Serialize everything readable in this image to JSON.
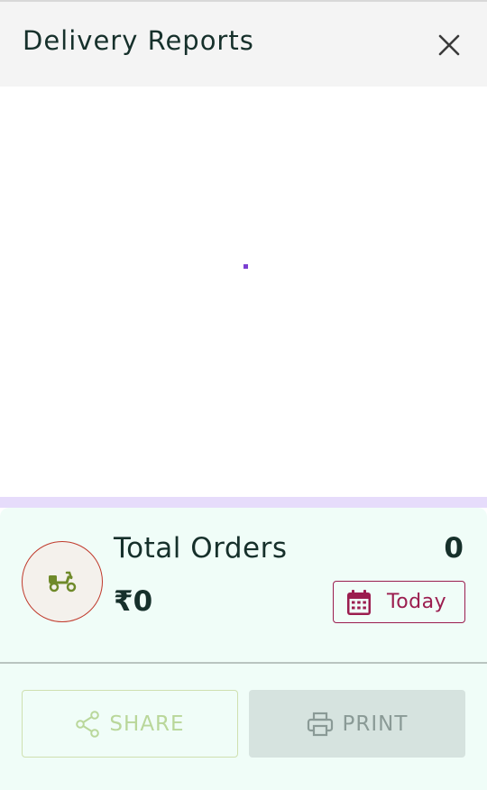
{
  "header": {
    "title": "Delivery Reports"
  },
  "summary": {
    "orders_label": "Total Orders",
    "orders_count": "0",
    "amount": "₹0",
    "date_filter_label": "Today"
  },
  "actions": {
    "share_label": "SHARE",
    "print_label": "PRINT"
  },
  "icons": {
    "close": "close-icon",
    "scooter": "scooter-icon",
    "calendar": "calendar-icon",
    "share": "share-icon",
    "print": "printer-icon"
  },
  "colors": {
    "header_bg": "#f4f4f4",
    "accent_purple": "#7b3fd1",
    "accent_strip": "#e6dcfb",
    "summary_bg": "#f0fdf8",
    "date_button": "#9b1d4f",
    "share_disabled": "#b9d79a",
    "print_disabled_bg": "#d6e3df"
  }
}
